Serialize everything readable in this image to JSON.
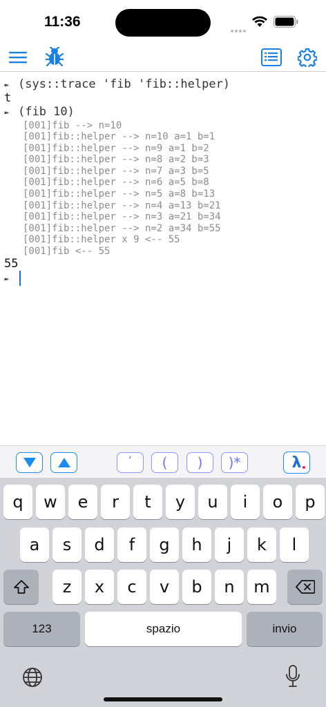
{
  "status": {
    "time": "11:36"
  },
  "nav": {
    "menu_icon": "hamburger-icon",
    "bug_icon": "bug-icon",
    "list_icon": "document-list-icon",
    "settings_icon": "gear-icon",
    "accent_color": "#1a7fe0"
  },
  "console": {
    "prompt_glyph": "➽",
    "lines": [
      {
        "type": "prompt",
        "text": "(sys::trace 'fib 'fib::helper)"
      },
      {
        "type": "result",
        "text": "t"
      },
      {
        "type": "prompt",
        "text": "(fib 10)"
      },
      {
        "type": "trace",
        "text": "[001]fib --> n=10"
      },
      {
        "type": "trace",
        "text": "[001]fib::helper --> n=10 a=1 b=1"
      },
      {
        "type": "trace",
        "text": "[001]fib::helper --> n=9 a=1 b=2"
      },
      {
        "type": "trace",
        "text": "[001]fib::helper --> n=8 a=2 b=3"
      },
      {
        "type": "trace",
        "text": "[001]fib::helper --> n=7 a=3 b=5"
      },
      {
        "type": "trace",
        "text": "[001]fib::helper --> n=6 a=5 b=8"
      },
      {
        "type": "trace",
        "text": "[001]fib::helper --> n=5 a=8 b=13"
      },
      {
        "type": "trace",
        "text": "[001]fib::helper --> n=4 a=13 b=21"
      },
      {
        "type": "trace",
        "text": "[001]fib::helper --> n=3 a=21 b=34"
      },
      {
        "type": "trace",
        "text": "[001]fib::helper --> n=2 a=34 b=55"
      },
      {
        "type": "trace",
        "text": "[001]fib::helper x 9 <-- 55"
      },
      {
        "type": "trace",
        "text": "[001]fib <-- 55"
      },
      {
        "type": "result",
        "text": "55"
      },
      {
        "type": "prompt",
        "text": ""
      }
    ]
  },
  "accessory": {
    "down_icon": "triangle-down-icon",
    "up_icon": "triangle-up-icon",
    "quote_label": "‘",
    "open_paren_label": "(",
    "close_paren_label": ")",
    "close_all_label": ")*",
    "lambda_label": "λ"
  },
  "keyboard": {
    "row1": [
      "q",
      "w",
      "e",
      "r",
      "t",
      "y",
      "u",
      "i",
      "o",
      "p"
    ],
    "row2": [
      "a",
      "s",
      "d",
      "f",
      "g",
      "h",
      "j",
      "k",
      "l"
    ],
    "row3": [
      "z",
      "x",
      "c",
      "v",
      "b",
      "n",
      "m"
    ],
    "numbers_label": "123",
    "space_label": "spazio",
    "return_label": "invio",
    "shift_icon": "shift-icon",
    "delete_icon": "backspace-icon",
    "globe_icon": "globe-icon",
    "mic_icon": "microphone-icon"
  }
}
